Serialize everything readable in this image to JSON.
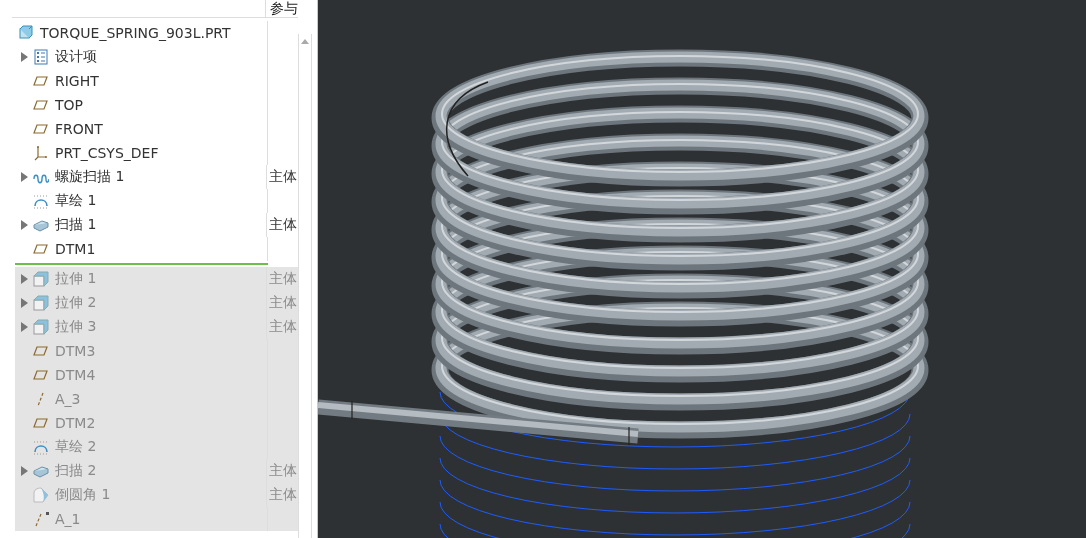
{
  "model_tree": {
    "columns": [
      {
        "label": "参与"
      }
    ],
    "items": [
      {
        "kind": "part",
        "label": "TORQUE_SPRING_903L.PRT",
        "expandable": false
      },
      {
        "kind": "design-items",
        "label": "设计项",
        "expandable": true
      },
      {
        "kind": "plane",
        "label": "RIGHT",
        "expandable": false
      },
      {
        "kind": "plane",
        "label": "TOP",
        "expandable": false
      },
      {
        "kind": "plane",
        "label": "FRONT",
        "expandable": false
      },
      {
        "kind": "csys",
        "label": "PRT_CSYS_DEF",
        "expandable": false
      },
      {
        "kind": "helix",
        "label": "螺旋扫描 1",
        "expandable": true,
        "body": "主体"
      },
      {
        "kind": "sketch",
        "label": "草绘 1",
        "expandable": false
      },
      {
        "kind": "sweep",
        "label": "扫描 1",
        "expandable": true,
        "body": "主体"
      },
      {
        "kind": "plane",
        "label": "DTM1",
        "expandable": false
      }
    ],
    "items_after_insert": [
      {
        "kind": "extrude",
        "label": "拉伸 1",
        "expandable": true,
        "body": "主体"
      },
      {
        "kind": "extrude",
        "label": "拉伸 2",
        "expandable": true,
        "body": "主体"
      },
      {
        "kind": "extrude",
        "label": "拉伸 3",
        "expandable": true,
        "body": "主体"
      },
      {
        "kind": "plane",
        "label": "DTM3",
        "expandable": false
      },
      {
        "kind": "plane",
        "label": "DTM4",
        "expandable": false
      },
      {
        "kind": "axis",
        "label": "A_3",
        "expandable": false
      },
      {
        "kind": "plane",
        "label": "DTM2",
        "expandable": false
      },
      {
        "kind": "sketch",
        "label": "草绘 2",
        "expandable": false
      },
      {
        "kind": "sweep",
        "label": "扫描 2",
        "expandable": true,
        "body": "主体"
      },
      {
        "kind": "round",
        "label": "倒圆角 1",
        "expandable": false,
        "body": "主体"
      },
      {
        "kind": "axis-flagged",
        "label": "A_1",
        "expandable": false
      }
    ]
  }
}
